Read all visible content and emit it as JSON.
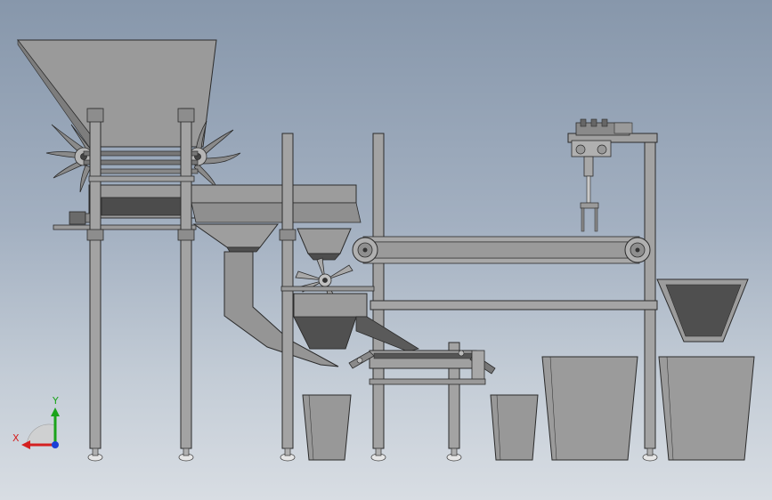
{
  "viewport": {
    "background_top": "#8797ab",
    "background_bottom": "#d8dde3"
  },
  "colors": {
    "steel_light": "#a0a0a0",
    "steel_mid": "#8c8c8c",
    "steel_dark": "#4a4a4a",
    "outline": "#2b2b2b",
    "hopper_fill": "#999999",
    "chute_dark": "#505050",
    "foot_pad": "#e6e6e6"
  },
  "triad": {
    "y_label": "Y",
    "x_label": "X",
    "y_color": "#1aa31a",
    "x_color": "#d42020",
    "z_color": "#1a3fd6",
    "icon": "coordinate-triad-icon"
  },
  "model": {
    "name": "",
    "view": ""
  }
}
